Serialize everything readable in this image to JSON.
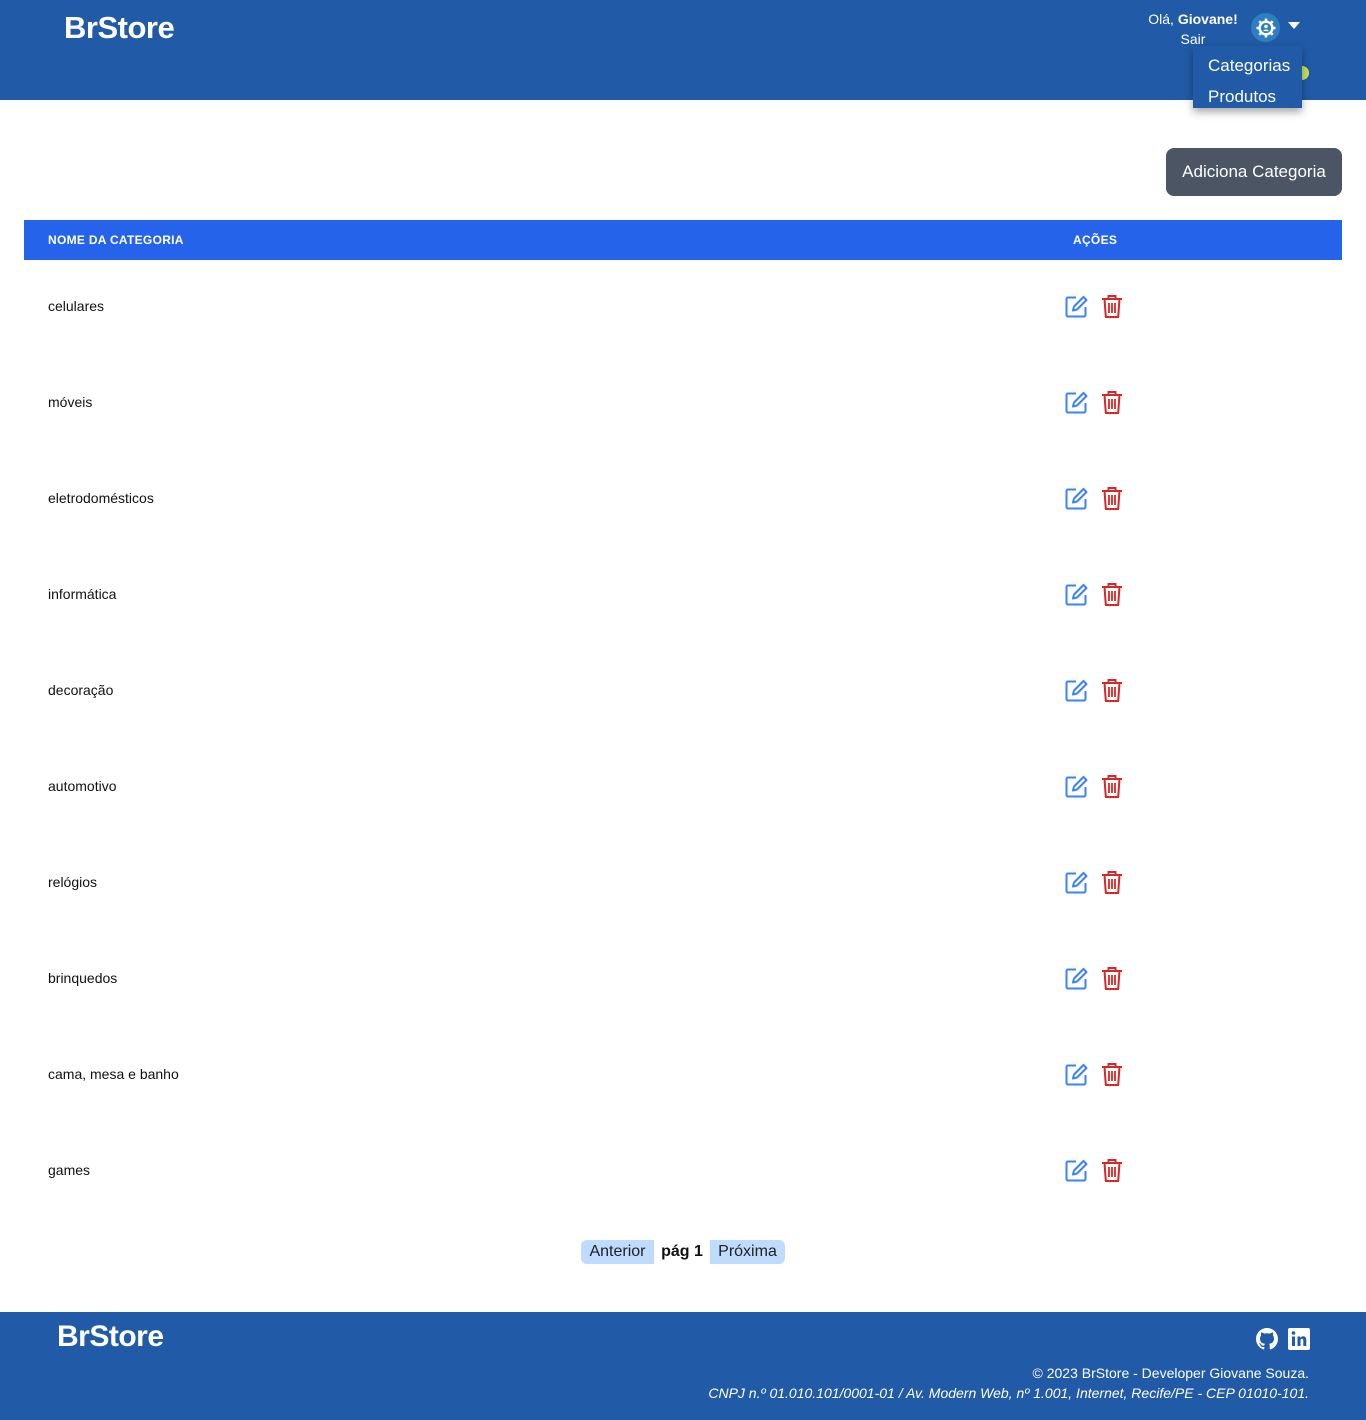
{
  "header": {
    "brand": "BrStore",
    "greeting_prefix": "Olá, ",
    "user_name": "Giovane!",
    "logout_label": "Sair",
    "menu": [
      {
        "label": "Categorias"
      },
      {
        "label": "Produtos"
      }
    ]
  },
  "toolbar": {
    "add_category_label": "Adiciona Categoria"
  },
  "table": {
    "columns": {
      "name": "NOME DA CATEGORIA",
      "actions": "AÇÕES"
    },
    "rows": [
      {
        "name": "celulares"
      },
      {
        "name": "móveis"
      },
      {
        "name": "eletrodomésticos"
      },
      {
        "name": "informática"
      },
      {
        "name": "decoração"
      },
      {
        "name": "automotivo"
      },
      {
        "name": "relógios"
      },
      {
        "name": "brinquedos"
      },
      {
        "name": "cama, mesa e banho"
      },
      {
        "name": "games"
      }
    ]
  },
  "pagination": {
    "prev_label": "Anterior",
    "page_label": "pág 1",
    "next_label": "Próxima"
  },
  "footer": {
    "brand": "BrStore",
    "copyright": "© 2023 BrStore - Developer Giovane Souza.",
    "address": "CNPJ n.º 01.010.101/0001-01 / Av. Modern Web, nº 1.001, Internet, Recife/PE - CEP 01010-101."
  },
  "colors": {
    "brand_blue": "#215aa6",
    "table_header": "#2563eb",
    "button_gray": "#4b5563",
    "pager_bg": "#bfdbfe",
    "edit_icon": "#3b82f6",
    "delete_icon": "#dc2626"
  },
  "icons": {
    "user_menu": "user-gear-icon",
    "menu_toggle": "caret-down-icon",
    "edit": "edit-icon",
    "delete": "trash-icon",
    "github": "github-icon",
    "linkedin": "linkedin-icon"
  }
}
